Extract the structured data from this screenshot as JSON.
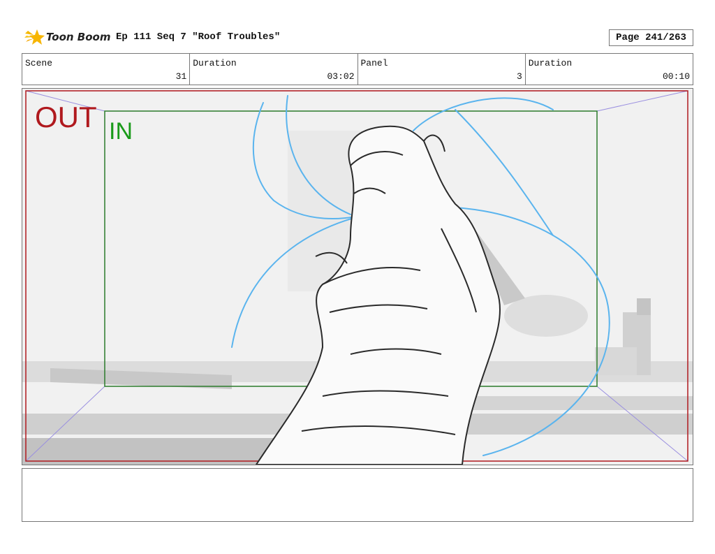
{
  "header": {
    "logo_text": "Toon Boom",
    "title": "Ep 111 Seq 7 \"Roof Troubles\"",
    "page": "Page 241/263"
  },
  "info": {
    "scene_label": "Scene",
    "scene_value": "31",
    "scene_duration_label": "Duration",
    "scene_duration_value": "03:02",
    "panel_label": "Panel",
    "panel_value": "3",
    "panel_duration_label": "Duration",
    "panel_duration_value": "00:10"
  },
  "panel": {
    "out_label": "OUT",
    "in_label": "IN",
    "out_frame_color": "#b0191e",
    "in_frame_color": "#2a7a2a",
    "sketch_color": "#5ab4ee"
  },
  "notes": {
    "text": ""
  }
}
